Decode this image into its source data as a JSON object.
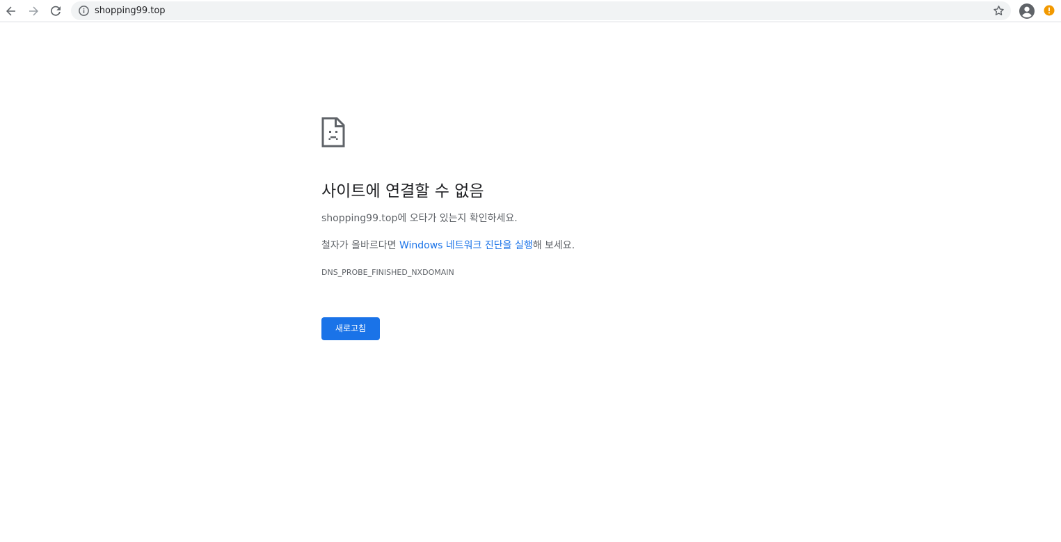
{
  "browser": {
    "url": "shopping99.top",
    "icons": {
      "back": "arrow-left-icon",
      "forward": "arrow-right-icon",
      "reload": "reload-icon",
      "site_info": "info-icon",
      "bookmark": "star-icon",
      "profile": "account-circle-icon",
      "alert": "alert-circle-icon"
    }
  },
  "error_page": {
    "icon": "sad-document-icon",
    "title": "사이트에 연결할 수 없음",
    "message_domain": "shopping99.top",
    "message_rest": "에 오타가 있는지 확인하세요.",
    "suggestion_prefix": "철자가 올바르다면 ",
    "suggestion_link": "Windows 네트워크 진단을 실행",
    "suggestion_suffix": "해 보세요.",
    "error_code": "DNS_PROBE_FINISHED_NXDOMAIN",
    "reload_label": "새로고침"
  },
  "colors": {
    "accent": "#1a73e8",
    "text_primary": "#202124",
    "text_secondary": "#5f6368",
    "alert": "#f29900"
  }
}
